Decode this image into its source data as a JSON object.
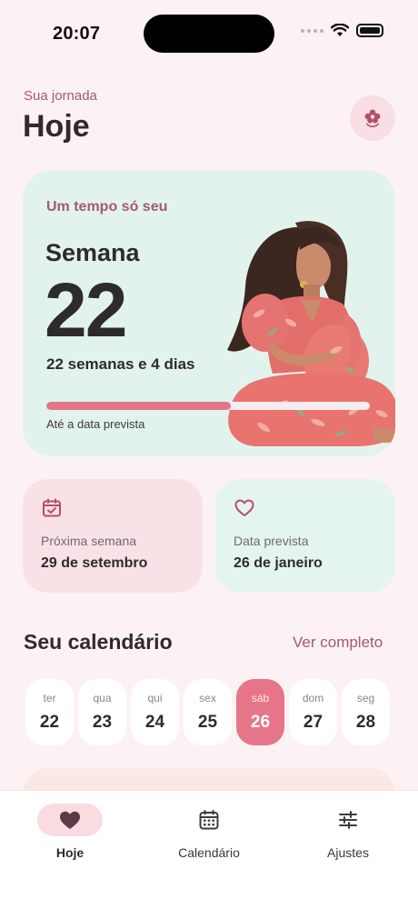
{
  "status_bar": {
    "time": "20:07"
  },
  "header": {
    "subtitle": "Sua jornada",
    "title": "Hoje",
    "profile_icon": "flower-icon"
  },
  "hero": {
    "tag": "Um tempo só seu",
    "week_label": "Semana",
    "week_number": "22",
    "detail": "22 semanas e 4 dias",
    "progress": 0.57,
    "caption": "Até a data prevista",
    "illustration": "pregnant-woman-illustration"
  },
  "cards": {
    "next_week": {
      "icon": "calendar-check-icon",
      "label": "Próxima semana",
      "value": "29 de setembro"
    },
    "due_date": {
      "icon": "heart-outline-icon",
      "label": "Data prevista",
      "value": "26 de janeiro"
    }
  },
  "calendar": {
    "title": "Seu calendário",
    "link": "Ver completo",
    "days": [
      {
        "name": "ter",
        "num": "22"
      },
      {
        "name": "qua",
        "num": "23"
      },
      {
        "name": "qui",
        "num": "24"
      },
      {
        "name": "sex",
        "num": "25"
      },
      {
        "name": "sáb",
        "num": "26"
      },
      {
        "name": "dom",
        "num": "27"
      },
      {
        "name": "seg",
        "num": "28"
      }
    ],
    "selected_index": 4
  },
  "tabs": [
    {
      "label": "Hoje",
      "icon": "heart-icon",
      "active": true
    },
    {
      "label": "Calendário",
      "icon": "calendar-icon",
      "active": false
    },
    {
      "label": "Ajustes",
      "icon": "sliders-icon",
      "active": false
    }
  ],
  "colors": {
    "accent": "#e6758a",
    "accent_text": "#a35a70",
    "mint": "#e2f3ee",
    "blush": "#f9e2e5"
  }
}
